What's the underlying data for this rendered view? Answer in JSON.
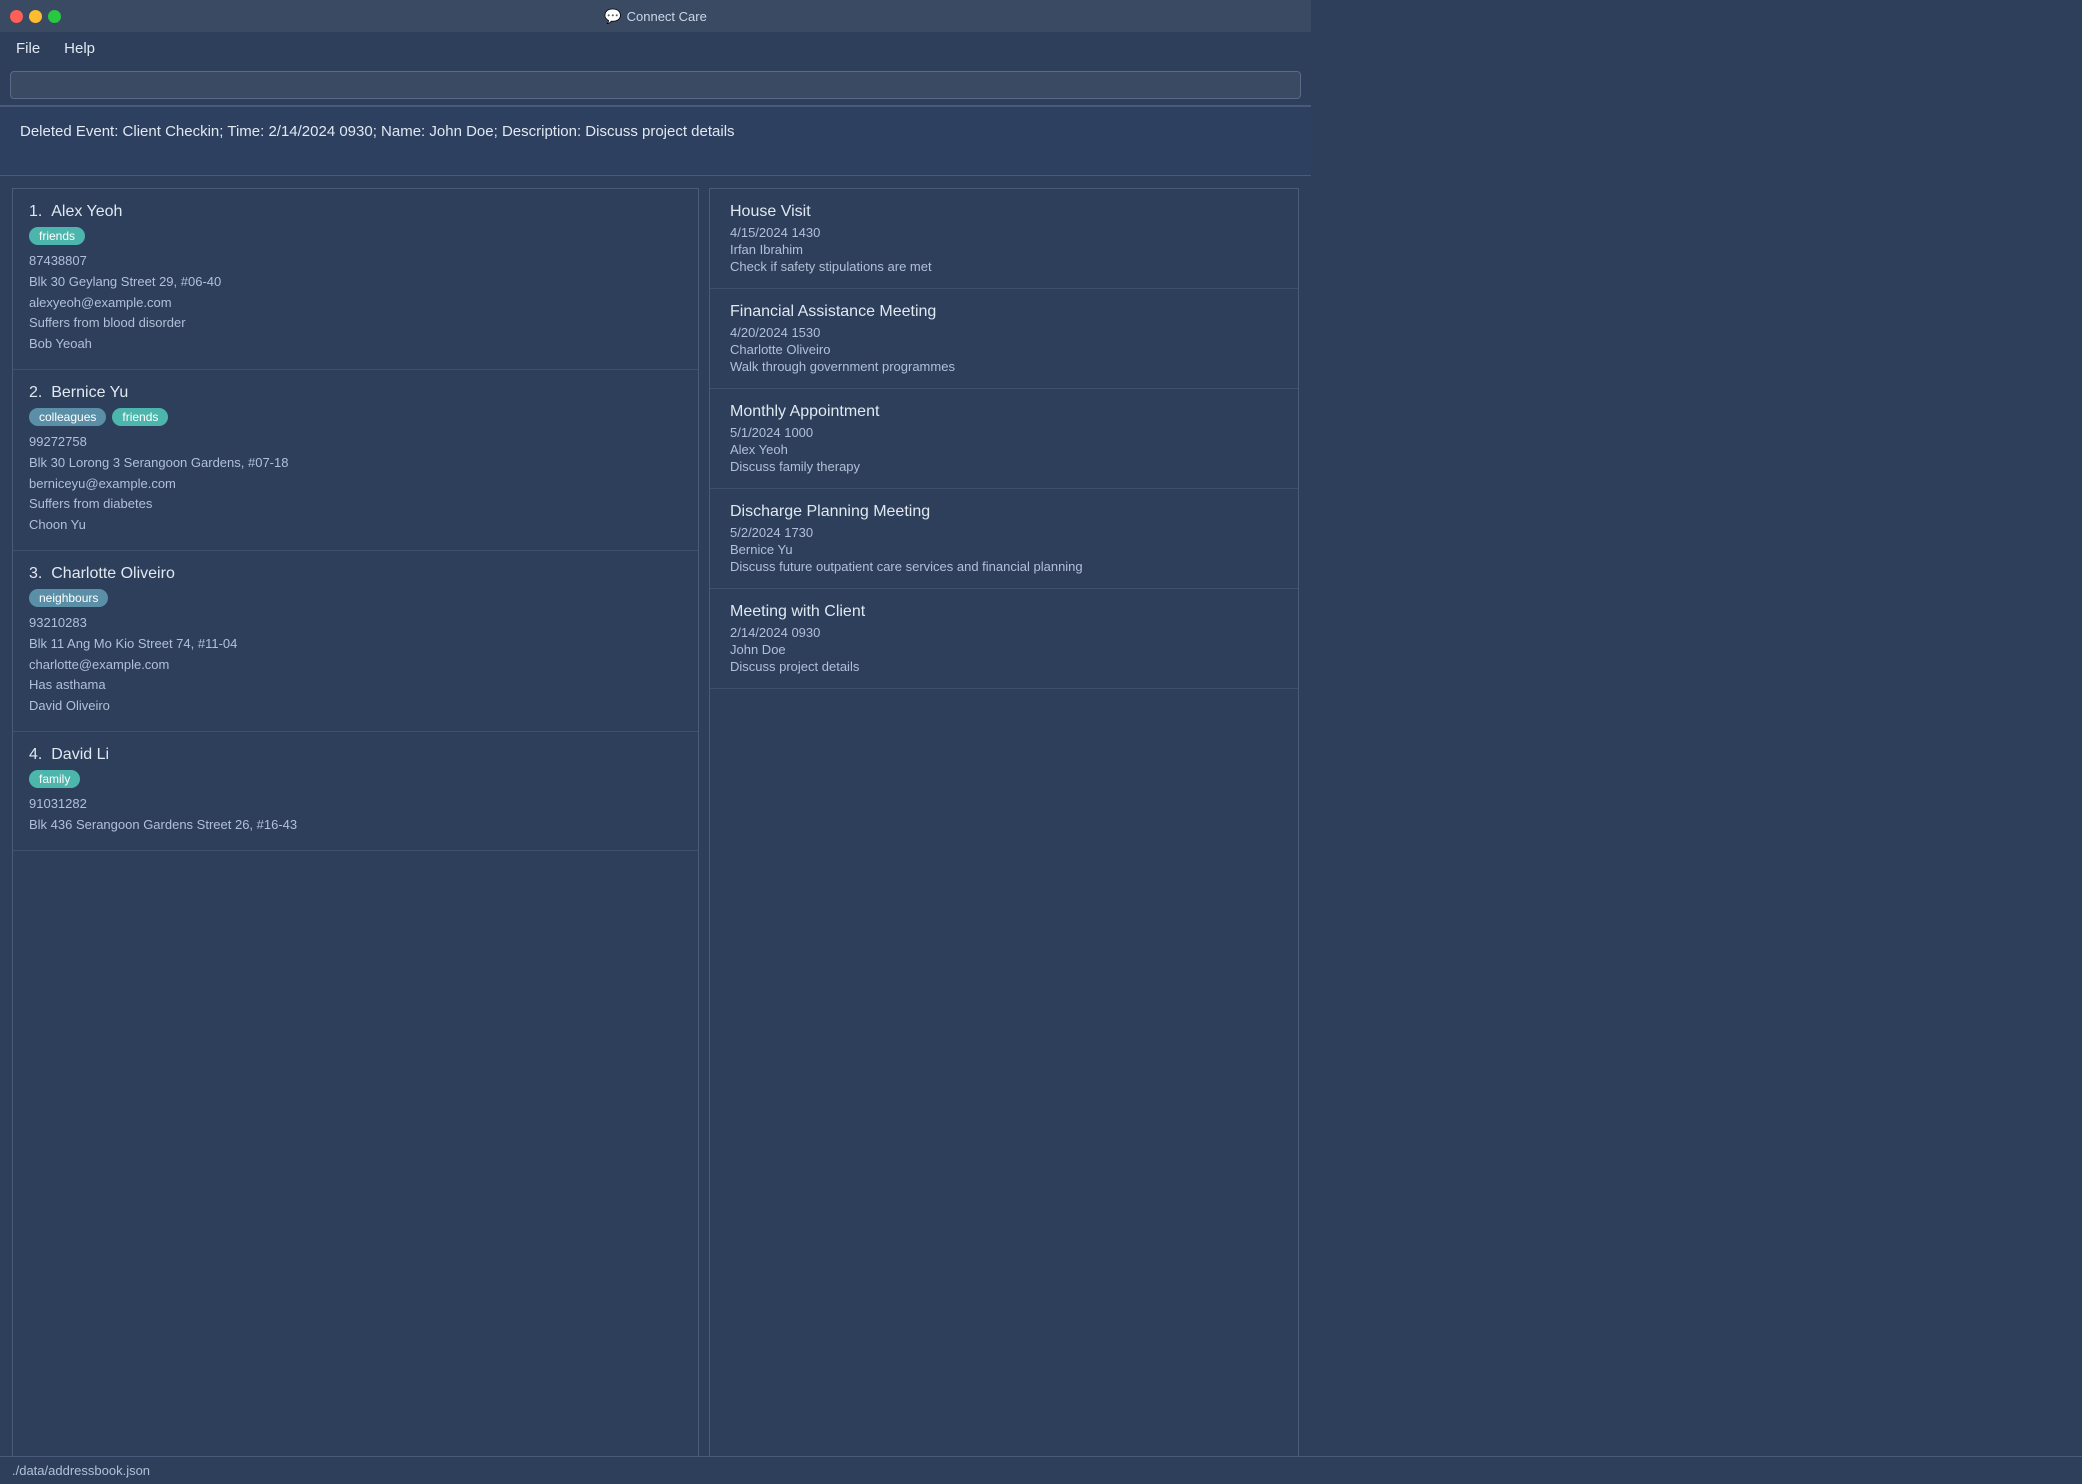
{
  "titleBar": {
    "title": "Connect Care",
    "icon": "💬"
  },
  "menuBar": {
    "items": [
      {
        "label": "File"
      },
      {
        "label": "Help"
      }
    ]
  },
  "toolbar": {
    "inputValue": "",
    "inputPlaceholder": ""
  },
  "notification": {
    "text": "Deleted Event: Client Checkin; Time: 2/14/2024 0930; Name: John Doe; Description: Discuss project details"
  },
  "contacts": [
    {
      "number": "1.",
      "name": "Alex Yeoh",
      "tags": [
        {
          "label": "friends",
          "type": "friends"
        }
      ],
      "phone": "87438807",
      "address": "Blk 30 Geylang Street 29, #06-40",
      "email": "alexyeoh@example.com",
      "condition": "Suffers from blood disorder",
      "emergency": "Bob Yeoah"
    },
    {
      "number": "2.",
      "name": "Bernice Yu",
      "tags": [
        {
          "label": "colleagues",
          "type": "colleagues"
        },
        {
          "label": "friends",
          "type": "friends"
        }
      ],
      "phone": "99272758",
      "address": "Blk 30 Lorong 3 Serangoon Gardens, #07-18",
      "email": "berniceyu@example.com",
      "condition": "Suffers from diabetes",
      "emergency": "Choon Yu"
    },
    {
      "number": "3.",
      "name": "Charlotte Oliveiro",
      "tags": [
        {
          "label": "neighbours",
          "type": "neighbours"
        }
      ],
      "phone": "93210283",
      "address": "Blk 11 Ang Mo Kio Street 74, #11-04",
      "email": "charlotte@example.com",
      "condition": "Has asthama",
      "emergency": "David Oliveiro"
    },
    {
      "number": "4.",
      "name": "David Li",
      "tags": [
        {
          "label": "family",
          "type": "family"
        }
      ],
      "phone": "91031282",
      "address": "Blk 436 Serangoon Gardens Street 26, #16-43",
      "email": "",
      "condition": "",
      "emergency": ""
    }
  ],
  "events": [
    {
      "title": "House Visit",
      "datetime": "4/15/2024 1430",
      "person": "Irfan Ibrahim",
      "description": "Check if safety stipulations are met"
    },
    {
      "title": "Financial Assistance Meeting",
      "datetime": "4/20/2024 1530",
      "person": "Charlotte Oliveiro",
      "description": "Walk through government programmes"
    },
    {
      "title": "Monthly Appointment",
      "datetime": "5/1/2024 1000",
      "person": "Alex Yeoh",
      "description": "Discuss family therapy"
    },
    {
      "title": "Discharge Planning Meeting",
      "datetime": "5/2/2024 1730",
      "person": "Bernice Yu",
      "description": "Discuss future outpatient care services and financial planning"
    },
    {
      "title": "Meeting with Client",
      "datetime": "2/14/2024 0930",
      "person": "John Doe",
      "description": "Discuss project details"
    }
  ],
  "statusBar": {
    "path": "./data/addressbook.json"
  }
}
